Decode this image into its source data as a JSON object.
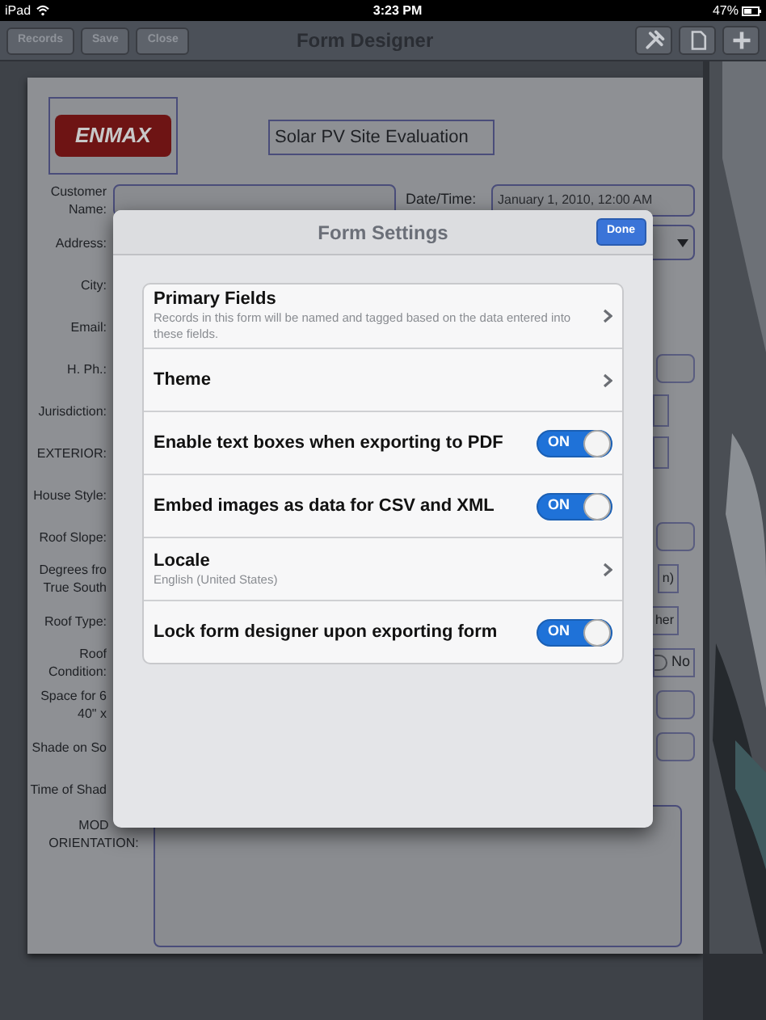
{
  "status_bar": {
    "device": "iPad",
    "time": "3:23 PM",
    "battery": "47%"
  },
  "toolbar": {
    "buttons": [
      "Records",
      "Save",
      "Close"
    ],
    "title": "Form Designer"
  },
  "form": {
    "logo": "ENMAX",
    "title": "Solar PV Site Evaluation",
    "rows": [
      {
        "label": "Customer\nName:",
        "kind": "field_date",
        "date_label": "Date/Time:",
        "date_value": "January 1, 2010, 12:00 AM"
      },
      {
        "label": "Address:",
        "kind": "dropdown"
      },
      {
        "label": "City:",
        "kind": "none"
      },
      {
        "label": "Email:",
        "kind": "none"
      },
      {
        "label": "H. Ph.:",
        "kind": "field"
      },
      {
        "label": "Jurisdiction:",
        "kind": "small_box"
      },
      {
        "label": "EXTERIOR:",
        "kind": "small_box"
      },
      {
        "label": "House Style:",
        "kind": "none"
      },
      {
        "label": "Roof Slope:",
        "kind": "field"
      },
      {
        "label": "Degrees fro\nTrue South",
        "kind": "button",
        "text": "n)"
      },
      {
        "label": "Roof Type:",
        "kind": "button",
        "text": "her"
      },
      {
        "label": "Roof\nCondition:",
        "kind": "radio",
        "text": "No",
        "selected": false
      },
      {
        "label": "Space for 6\n40\" x",
        "kind": "field"
      },
      {
        "label": "Shade on So",
        "kind": "field"
      },
      {
        "label": "Time of Shad",
        "kind": "none"
      },
      {
        "label": "MOD\nORIENTATION:",
        "kind": "area"
      }
    ]
  },
  "dialog": {
    "title": "Form Settings",
    "done": "Done",
    "items": [
      {
        "kind": "link",
        "title": "Primary Fields",
        "subtitle": "Records in this form will be named and tagged based on the data entered into these fields."
      },
      {
        "kind": "link",
        "title": "Theme"
      },
      {
        "kind": "toggle",
        "title": "Enable text boxes when exporting to PDF",
        "on": true,
        "switch_text": "ON"
      },
      {
        "kind": "toggle",
        "title": "Embed images as data for CSV and XML",
        "on": true,
        "switch_text": "ON"
      },
      {
        "kind": "link",
        "title": "Locale",
        "subtitle": "English (United States)"
      },
      {
        "kind": "toggle",
        "title": "Lock form designer upon exporting form",
        "on": true,
        "switch_text": "ON"
      }
    ]
  }
}
